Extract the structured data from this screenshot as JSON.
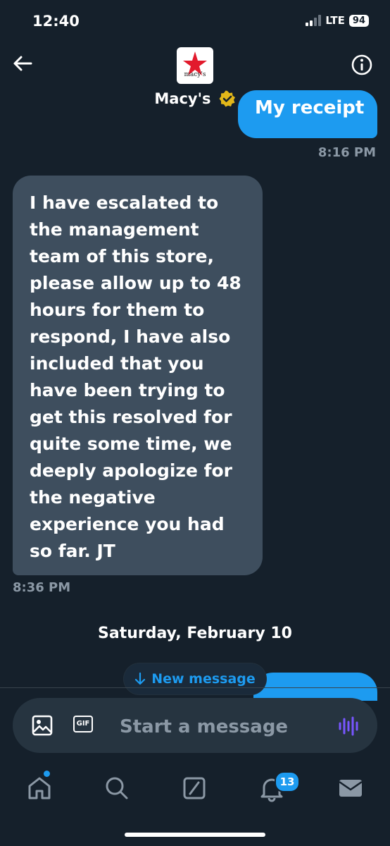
{
  "status_bar": {
    "time": "12:40",
    "network": "LTE",
    "battery": "94"
  },
  "header": {
    "name": "Macy's",
    "avatar_text": "macy's"
  },
  "messages": {
    "top_bubble_text": "My receipt",
    "top_time": "8:16 PM",
    "received_text": "I have escalated to\nthe management\nteam of this store,\nplease allow up to 48\nhours for them to\nrespond, I have also\nincluded that you\nhave been trying to\nget this resolved for\nquite some time, we\ndeeply apologize for\nthe negative\nexperience you had\nso far. JT",
    "received_time": "8:36 PM",
    "date_divider": "Saturday, February 10",
    "new_message_label": "New message"
  },
  "composer": {
    "placeholder": "Start a message",
    "gif_label": "GIF"
  },
  "nav": {
    "notifications_count": "13"
  },
  "colors": {
    "accent": "#1d9bf0",
    "background": "#15202b",
    "bubble": "#3e4e5e",
    "brand_red": "#e21a2c"
  }
}
